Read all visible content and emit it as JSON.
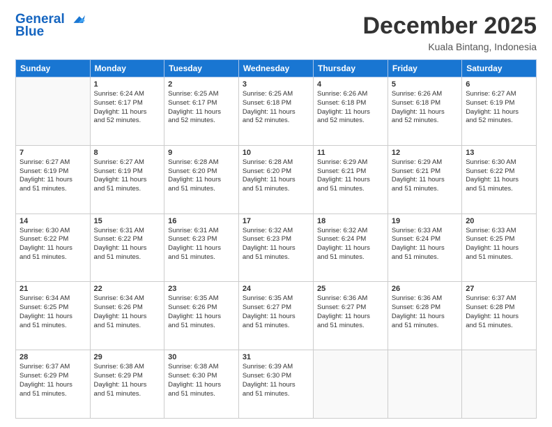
{
  "logo": {
    "line1": "General",
    "line2": "Blue"
  },
  "header": {
    "month": "December 2025",
    "location": "Kuala Bintang, Indonesia"
  },
  "days_of_week": [
    "Sunday",
    "Monday",
    "Tuesday",
    "Wednesday",
    "Thursday",
    "Friday",
    "Saturday"
  ],
  "weeks": [
    [
      {
        "day": "",
        "sunrise": "",
        "sunset": "",
        "daylight": ""
      },
      {
        "day": "1",
        "sunrise": "Sunrise: 6:24 AM",
        "sunset": "Sunset: 6:17 PM",
        "daylight": "Daylight: 11 hours and 52 minutes."
      },
      {
        "day": "2",
        "sunrise": "Sunrise: 6:25 AM",
        "sunset": "Sunset: 6:17 PM",
        "daylight": "Daylight: 11 hours and 52 minutes."
      },
      {
        "day": "3",
        "sunrise": "Sunrise: 6:25 AM",
        "sunset": "Sunset: 6:18 PM",
        "daylight": "Daylight: 11 hours and 52 minutes."
      },
      {
        "day": "4",
        "sunrise": "Sunrise: 6:26 AM",
        "sunset": "Sunset: 6:18 PM",
        "daylight": "Daylight: 11 hours and 52 minutes."
      },
      {
        "day": "5",
        "sunrise": "Sunrise: 6:26 AM",
        "sunset": "Sunset: 6:18 PM",
        "daylight": "Daylight: 11 hours and 52 minutes."
      },
      {
        "day": "6",
        "sunrise": "Sunrise: 6:27 AM",
        "sunset": "Sunset: 6:19 PM",
        "daylight": "Daylight: 11 hours and 52 minutes."
      }
    ],
    [
      {
        "day": "7",
        "sunrise": "Sunrise: 6:27 AM",
        "sunset": "Sunset: 6:19 PM",
        "daylight": "Daylight: 11 hours and 51 minutes."
      },
      {
        "day": "8",
        "sunrise": "Sunrise: 6:27 AM",
        "sunset": "Sunset: 6:19 PM",
        "daylight": "Daylight: 11 hours and 51 minutes."
      },
      {
        "day": "9",
        "sunrise": "Sunrise: 6:28 AM",
        "sunset": "Sunset: 6:20 PM",
        "daylight": "Daylight: 11 hours and 51 minutes."
      },
      {
        "day": "10",
        "sunrise": "Sunrise: 6:28 AM",
        "sunset": "Sunset: 6:20 PM",
        "daylight": "Daylight: 11 hours and 51 minutes."
      },
      {
        "day": "11",
        "sunrise": "Sunrise: 6:29 AM",
        "sunset": "Sunset: 6:21 PM",
        "daylight": "Daylight: 11 hours and 51 minutes."
      },
      {
        "day": "12",
        "sunrise": "Sunrise: 6:29 AM",
        "sunset": "Sunset: 6:21 PM",
        "daylight": "Daylight: 11 hours and 51 minutes."
      },
      {
        "day": "13",
        "sunrise": "Sunrise: 6:30 AM",
        "sunset": "Sunset: 6:22 PM",
        "daylight": "Daylight: 11 hours and 51 minutes."
      }
    ],
    [
      {
        "day": "14",
        "sunrise": "Sunrise: 6:30 AM",
        "sunset": "Sunset: 6:22 PM",
        "daylight": "Daylight: 11 hours and 51 minutes."
      },
      {
        "day": "15",
        "sunrise": "Sunrise: 6:31 AM",
        "sunset": "Sunset: 6:22 PM",
        "daylight": "Daylight: 11 hours and 51 minutes."
      },
      {
        "day": "16",
        "sunrise": "Sunrise: 6:31 AM",
        "sunset": "Sunset: 6:23 PM",
        "daylight": "Daylight: 11 hours and 51 minutes."
      },
      {
        "day": "17",
        "sunrise": "Sunrise: 6:32 AM",
        "sunset": "Sunset: 6:23 PM",
        "daylight": "Daylight: 11 hours and 51 minutes."
      },
      {
        "day": "18",
        "sunrise": "Sunrise: 6:32 AM",
        "sunset": "Sunset: 6:24 PM",
        "daylight": "Daylight: 11 hours and 51 minutes."
      },
      {
        "day": "19",
        "sunrise": "Sunrise: 6:33 AM",
        "sunset": "Sunset: 6:24 PM",
        "daylight": "Daylight: 11 hours and 51 minutes."
      },
      {
        "day": "20",
        "sunrise": "Sunrise: 6:33 AM",
        "sunset": "Sunset: 6:25 PM",
        "daylight": "Daylight: 11 hours and 51 minutes."
      }
    ],
    [
      {
        "day": "21",
        "sunrise": "Sunrise: 6:34 AM",
        "sunset": "Sunset: 6:25 PM",
        "daylight": "Daylight: 11 hours and 51 minutes."
      },
      {
        "day": "22",
        "sunrise": "Sunrise: 6:34 AM",
        "sunset": "Sunset: 6:26 PM",
        "daylight": "Daylight: 11 hours and 51 minutes."
      },
      {
        "day": "23",
        "sunrise": "Sunrise: 6:35 AM",
        "sunset": "Sunset: 6:26 PM",
        "daylight": "Daylight: 11 hours and 51 minutes."
      },
      {
        "day": "24",
        "sunrise": "Sunrise: 6:35 AM",
        "sunset": "Sunset: 6:27 PM",
        "daylight": "Daylight: 11 hours and 51 minutes."
      },
      {
        "day": "25",
        "sunrise": "Sunrise: 6:36 AM",
        "sunset": "Sunset: 6:27 PM",
        "daylight": "Daylight: 11 hours and 51 minutes."
      },
      {
        "day": "26",
        "sunrise": "Sunrise: 6:36 AM",
        "sunset": "Sunset: 6:28 PM",
        "daylight": "Daylight: 11 hours and 51 minutes."
      },
      {
        "day": "27",
        "sunrise": "Sunrise: 6:37 AM",
        "sunset": "Sunset: 6:28 PM",
        "daylight": "Daylight: 11 hours and 51 minutes."
      }
    ],
    [
      {
        "day": "28",
        "sunrise": "Sunrise: 6:37 AM",
        "sunset": "Sunset: 6:29 PM",
        "daylight": "Daylight: 11 hours and 51 minutes."
      },
      {
        "day": "29",
        "sunrise": "Sunrise: 6:38 AM",
        "sunset": "Sunset: 6:29 PM",
        "daylight": "Daylight: 11 hours and 51 minutes."
      },
      {
        "day": "30",
        "sunrise": "Sunrise: 6:38 AM",
        "sunset": "Sunset: 6:30 PM",
        "daylight": "Daylight: 11 hours and 51 minutes."
      },
      {
        "day": "31",
        "sunrise": "Sunrise: 6:39 AM",
        "sunset": "Sunset: 6:30 PM",
        "daylight": "Daylight: 11 hours and 51 minutes."
      },
      {
        "day": "",
        "sunrise": "",
        "sunset": "",
        "daylight": ""
      },
      {
        "day": "",
        "sunrise": "",
        "sunset": "",
        "daylight": ""
      },
      {
        "day": "",
        "sunrise": "",
        "sunset": "",
        "daylight": ""
      }
    ]
  ]
}
